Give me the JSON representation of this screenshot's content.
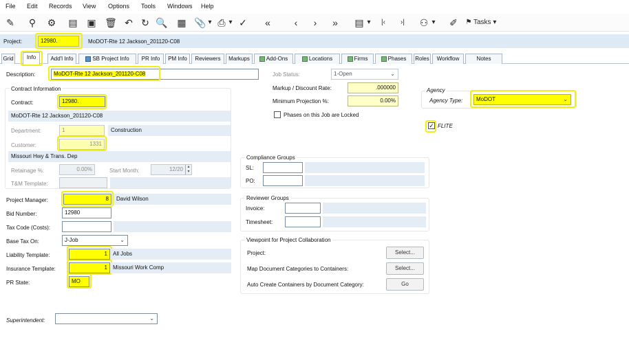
{
  "menu": [
    "File",
    "Edit",
    "Records",
    "View",
    "Options",
    "Tools",
    "Windows",
    "Help"
  ],
  "toolbar": {
    "tasks_label": "Tasks"
  },
  "project": {
    "label": "Project:",
    "number": "12980.",
    "name": "MoDOT-Rte 12 Jackson_201120-C08"
  },
  "tabs": [
    "Grid",
    "Info",
    "Add'l Info",
    "SB Project Info",
    "PR Info",
    "PM Info",
    "Reviewers",
    "Markups",
    "Add-Ons",
    "Locations",
    "Firms",
    "Phases",
    "Roles",
    "Workflow",
    "Notes"
  ],
  "description": {
    "label": "Description:",
    "value": "MoDOT-Rte 12 Jackson_201120-C08"
  },
  "job_status": {
    "label": "Job Status:",
    "value": "1-Open"
  },
  "markup": {
    "label": "Markup / Discount Rate:",
    "value": ".000000"
  },
  "min_projection": {
    "label": "Minimum Projection %:",
    "value": "0.00%"
  },
  "phases_locked": {
    "label": "Phases on this Job are Locked"
  },
  "contract_info": {
    "title": "Contract Information",
    "contract_label": "Contract:",
    "contract_value": "12980.",
    "contract_desc": "MoDOT-Rte 12 Jackson_201120-C08",
    "department_label": "Department:",
    "department_value": "1",
    "department_name": "Construction",
    "customer_label": "Customer:",
    "customer_value": "1331",
    "customer_name": "Missouri Hwy & Trans. Dep",
    "retainage_label": "Retainage %:",
    "retainage_value": "0.00%",
    "start_month_label": "Start Month:",
    "start_month_value": "12/20",
    "tm_template_label": "T&M Template:"
  },
  "agency": {
    "title": "Agency",
    "type_label": "Agency Type:",
    "type_value": "MoDOT"
  },
  "flite": {
    "label": "FLITE"
  },
  "compliance": {
    "title": "Compliance Groups",
    "sl": "SL:",
    "po": "PO:"
  },
  "reviewer": {
    "title": "Reviewer Groups",
    "invoice": "Invoice:",
    "timesheet": "Timesheet:"
  },
  "viewpoint": {
    "title": "Viewpoint for Project Collaboration",
    "project": "Project:",
    "map_docs": "Map Document Categories to Containers:",
    "auto_create": "Auto Create Containers by Document Category:",
    "select": "Select...",
    "go": "Go"
  },
  "pm": {
    "label": "Project Manager:",
    "value": "8",
    "name": "David Wilson"
  },
  "bid": {
    "label": "Bid Number:",
    "value": "12980"
  },
  "tax_code": {
    "label": "Tax Code (Costs):"
  },
  "base_tax": {
    "label": "Base Tax On:",
    "value": "J-Job"
  },
  "liability": {
    "label": "Liability Template:",
    "value": "1",
    "name": "All Jobs"
  },
  "insurance": {
    "label": "Insurance Template:",
    "value": "1",
    "name": "Missouri Work Comp"
  },
  "pr_state": {
    "label": "PR State:",
    "value": "MO"
  },
  "superintendent": {
    "label": "Superintendent:"
  }
}
